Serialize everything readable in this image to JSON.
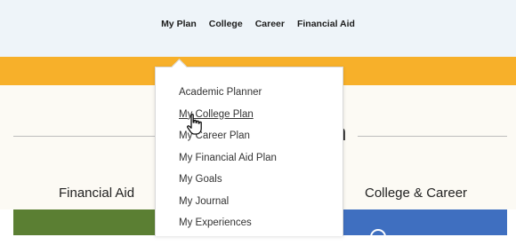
{
  "topnav": {
    "items": [
      "My Plan",
      "College",
      "Career",
      "Financial Aid"
    ]
  },
  "dropdown": {
    "items": [
      "Academic Planner",
      "My College Plan",
      "My Career Plan",
      "My Financial Aid Plan",
      "My Goals",
      "My Journal",
      "My Experiences"
    ],
    "hovered_item": "My College Plan"
  },
  "hero": {
    "title_fragment": "n"
  },
  "sections": {
    "left_label": "Financial Aid",
    "right_label": "College & Career"
  },
  "colors": {
    "nav_bg": "#eef4f9",
    "accent_yellow": "#f7b02a",
    "cream_bg": "#fcfaf4",
    "green_card": "#5b7f33",
    "blue_card": "#3f6fc0"
  },
  "icons": {
    "cursor": "hand-pointer-icon",
    "blue_card_icon": "circle-icon"
  }
}
